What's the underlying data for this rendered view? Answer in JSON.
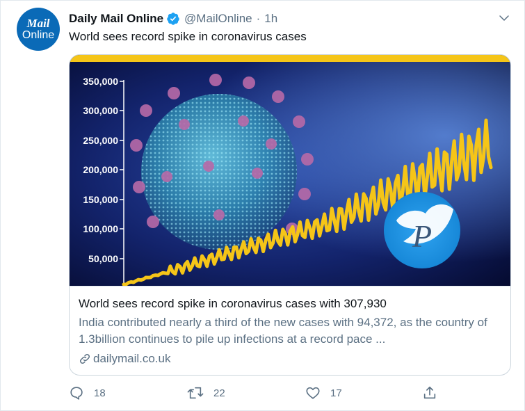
{
  "tweet": {
    "author_name": "Daily Mail Online",
    "handle": "@MailOnline",
    "separator": "·",
    "time": "1h",
    "text": "World sees record spike in coronavirus cases",
    "avatar": {
      "line1": "Mail",
      "line2": "Online",
      "color": "#0a6ab7"
    }
  },
  "card": {
    "title": "World sees record spike in coronavirus cases with 307,930",
    "description": "India contributed nearly a third of the new cases with 94,372, as the country of 1.3billion continues to pile up infections at a record pace ...",
    "domain": "dailymail.co.uk",
    "image": {
      "y_tick_labels": [
        "350,000",
        "300,000",
        "250,000",
        "200,000",
        "150,000",
        "100,000",
        "50,000"
      ],
      "line_color": "#f5c518",
      "banner_color": "#f5c518",
      "watermark_letter": "P"
    }
  },
  "actions": {
    "reply_count": "18",
    "retweet_count": "22",
    "like_count": "17"
  },
  "colors": {
    "accent": "#1da1f2",
    "secondary_text": "#5b7083",
    "border": "#e1e8ed"
  }
}
